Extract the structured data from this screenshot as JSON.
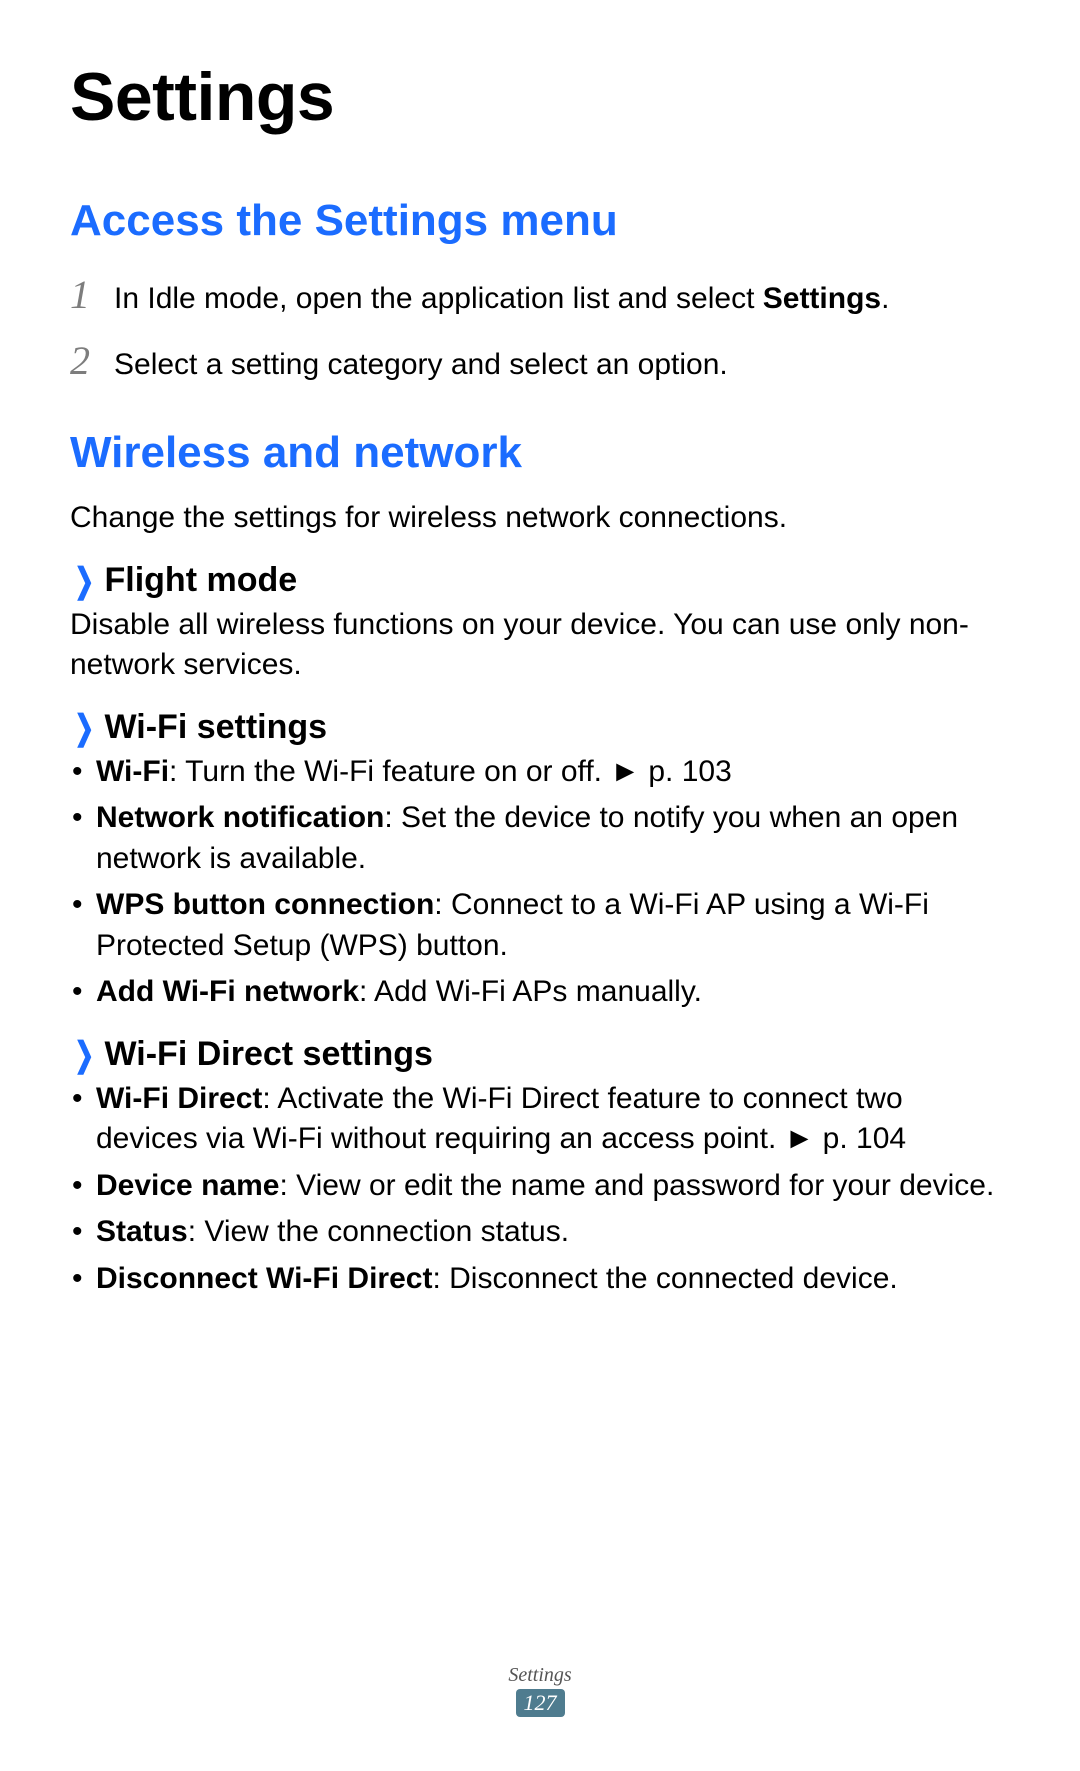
{
  "title": "Settings",
  "sections": {
    "access": {
      "heading": "Access the Settings menu",
      "steps": [
        {
          "n": "1",
          "prefix": "In Idle mode, open the application list and select ",
          "bold": "Settings",
          "suffix": "."
        },
        {
          "n": "2",
          "prefix": "Select a setting category and select an option.",
          "bold": "",
          "suffix": ""
        }
      ]
    },
    "wireless": {
      "heading": "Wireless and network",
      "intro": "Change the settings for wireless network connections.",
      "flight": {
        "title": "Flight mode",
        "body": "Disable all wireless functions on your device. You can use only non-network services."
      },
      "wifi": {
        "title": "Wi-Fi settings",
        "items": [
          {
            "bold": "Wi-Fi",
            "text": ": Turn the Wi-Fi feature on or off. ► p. 103"
          },
          {
            "bold": "Network notification",
            "text": ": Set the device to notify you when an open network is available."
          },
          {
            "bold": "WPS button connection",
            "text": ": Connect to a Wi-Fi AP using a Wi-Fi Protected Setup (WPS) button."
          },
          {
            "bold": "Add Wi-Fi network",
            "text": ": Add Wi-Fi APs manually."
          }
        ]
      },
      "wifidirect": {
        "title": "Wi-Fi Direct settings",
        "items": [
          {
            "bold": "Wi-Fi Direct",
            "text": ": Activate the Wi-Fi Direct feature to connect two devices via Wi-Fi without requiring an access point. ► p. 104"
          },
          {
            "bold": "Device name",
            "text": ": View or edit the name and password for your device."
          },
          {
            "bold": "Status",
            "text": ": View the connection status."
          },
          {
            "bold": "Disconnect Wi-Fi Direct",
            "text": ": Disconnect the connected device."
          }
        ]
      }
    }
  },
  "footer": {
    "label": "Settings",
    "page": "127"
  }
}
